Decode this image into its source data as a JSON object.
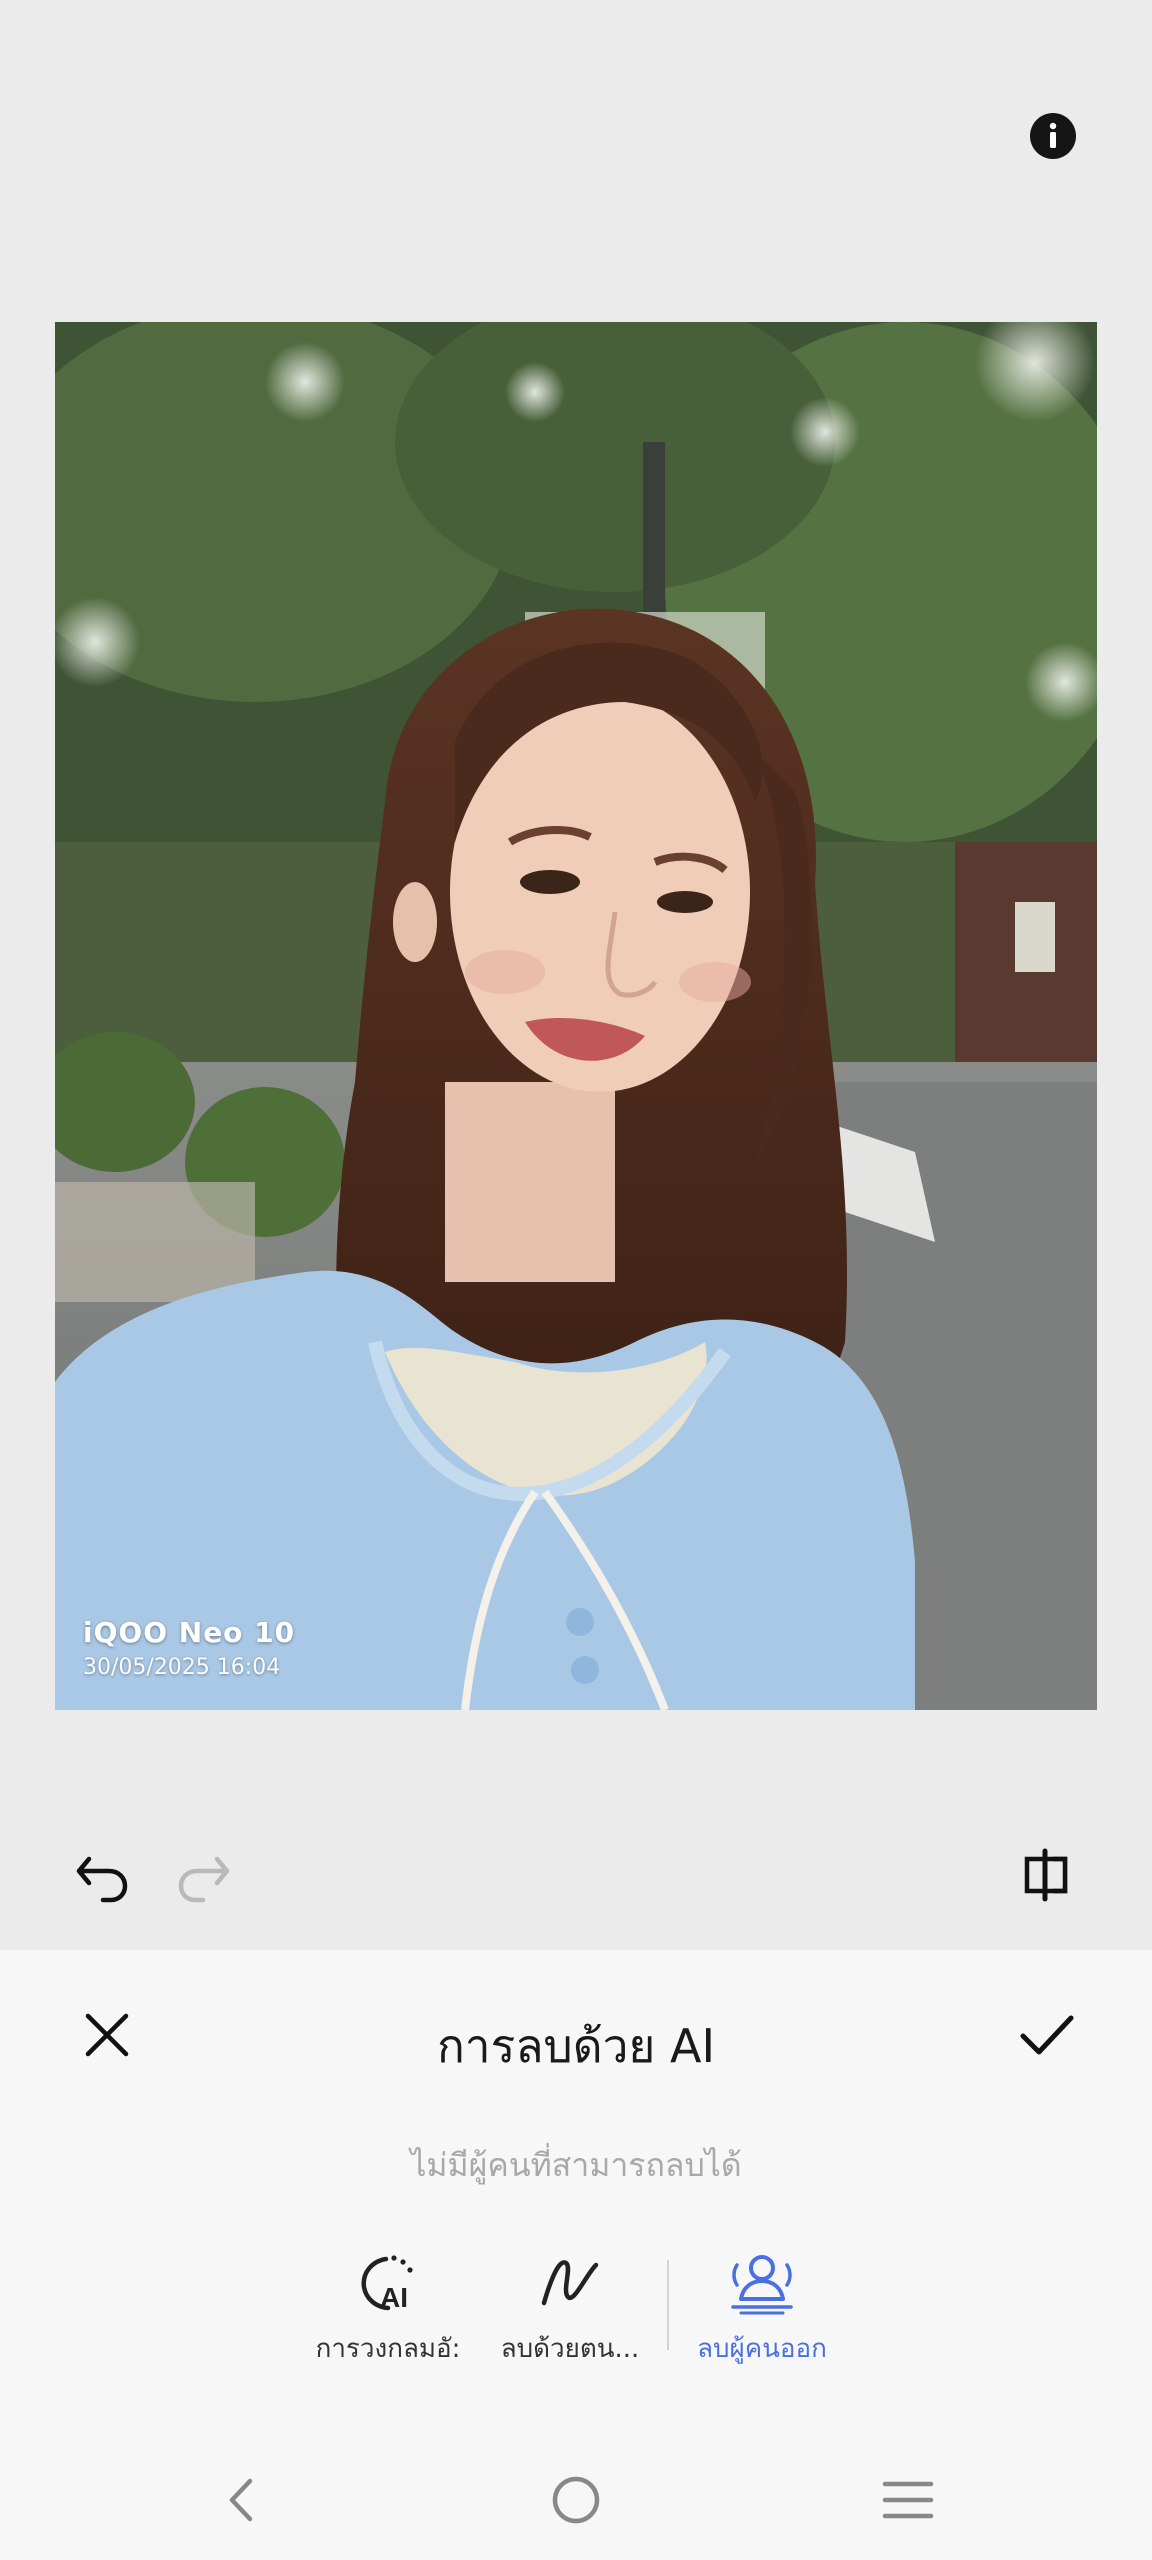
{
  "header": {
    "info_icon": "info-icon"
  },
  "photo": {
    "watermark_brand": "iQOO Neo 10",
    "watermark_date": "30/05/2025 16:04"
  },
  "edit_toolbar": {
    "undo_icon": "undo-icon",
    "redo_icon": "redo-icon",
    "compare_icon": "compare-icon"
  },
  "panel": {
    "title": "การลบด้วย AI",
    "status": "ไม่มีผู้คนที่สามารถลบได้",
    "modes": [
      {
        "label": "การวงกลมอั:",
        "icon": "ai-circle-icon",
        "active": false
      },
      {
        "label": "ลบด้วยตน...",
        "icon": "manual-erase-icon",
        "active": false
      },
      {
        "label": "ลบผู้คนออก",
        "icon": "remove-people-icon",
        "active": true
      }
    ],
    "accent_color": "#4a6fe0"
  },
  "navbar": {
    "back_icon": "back-icon",
    "home_icon": "home-icon",
    "menu_icon": "menu-icon"
  }
}
